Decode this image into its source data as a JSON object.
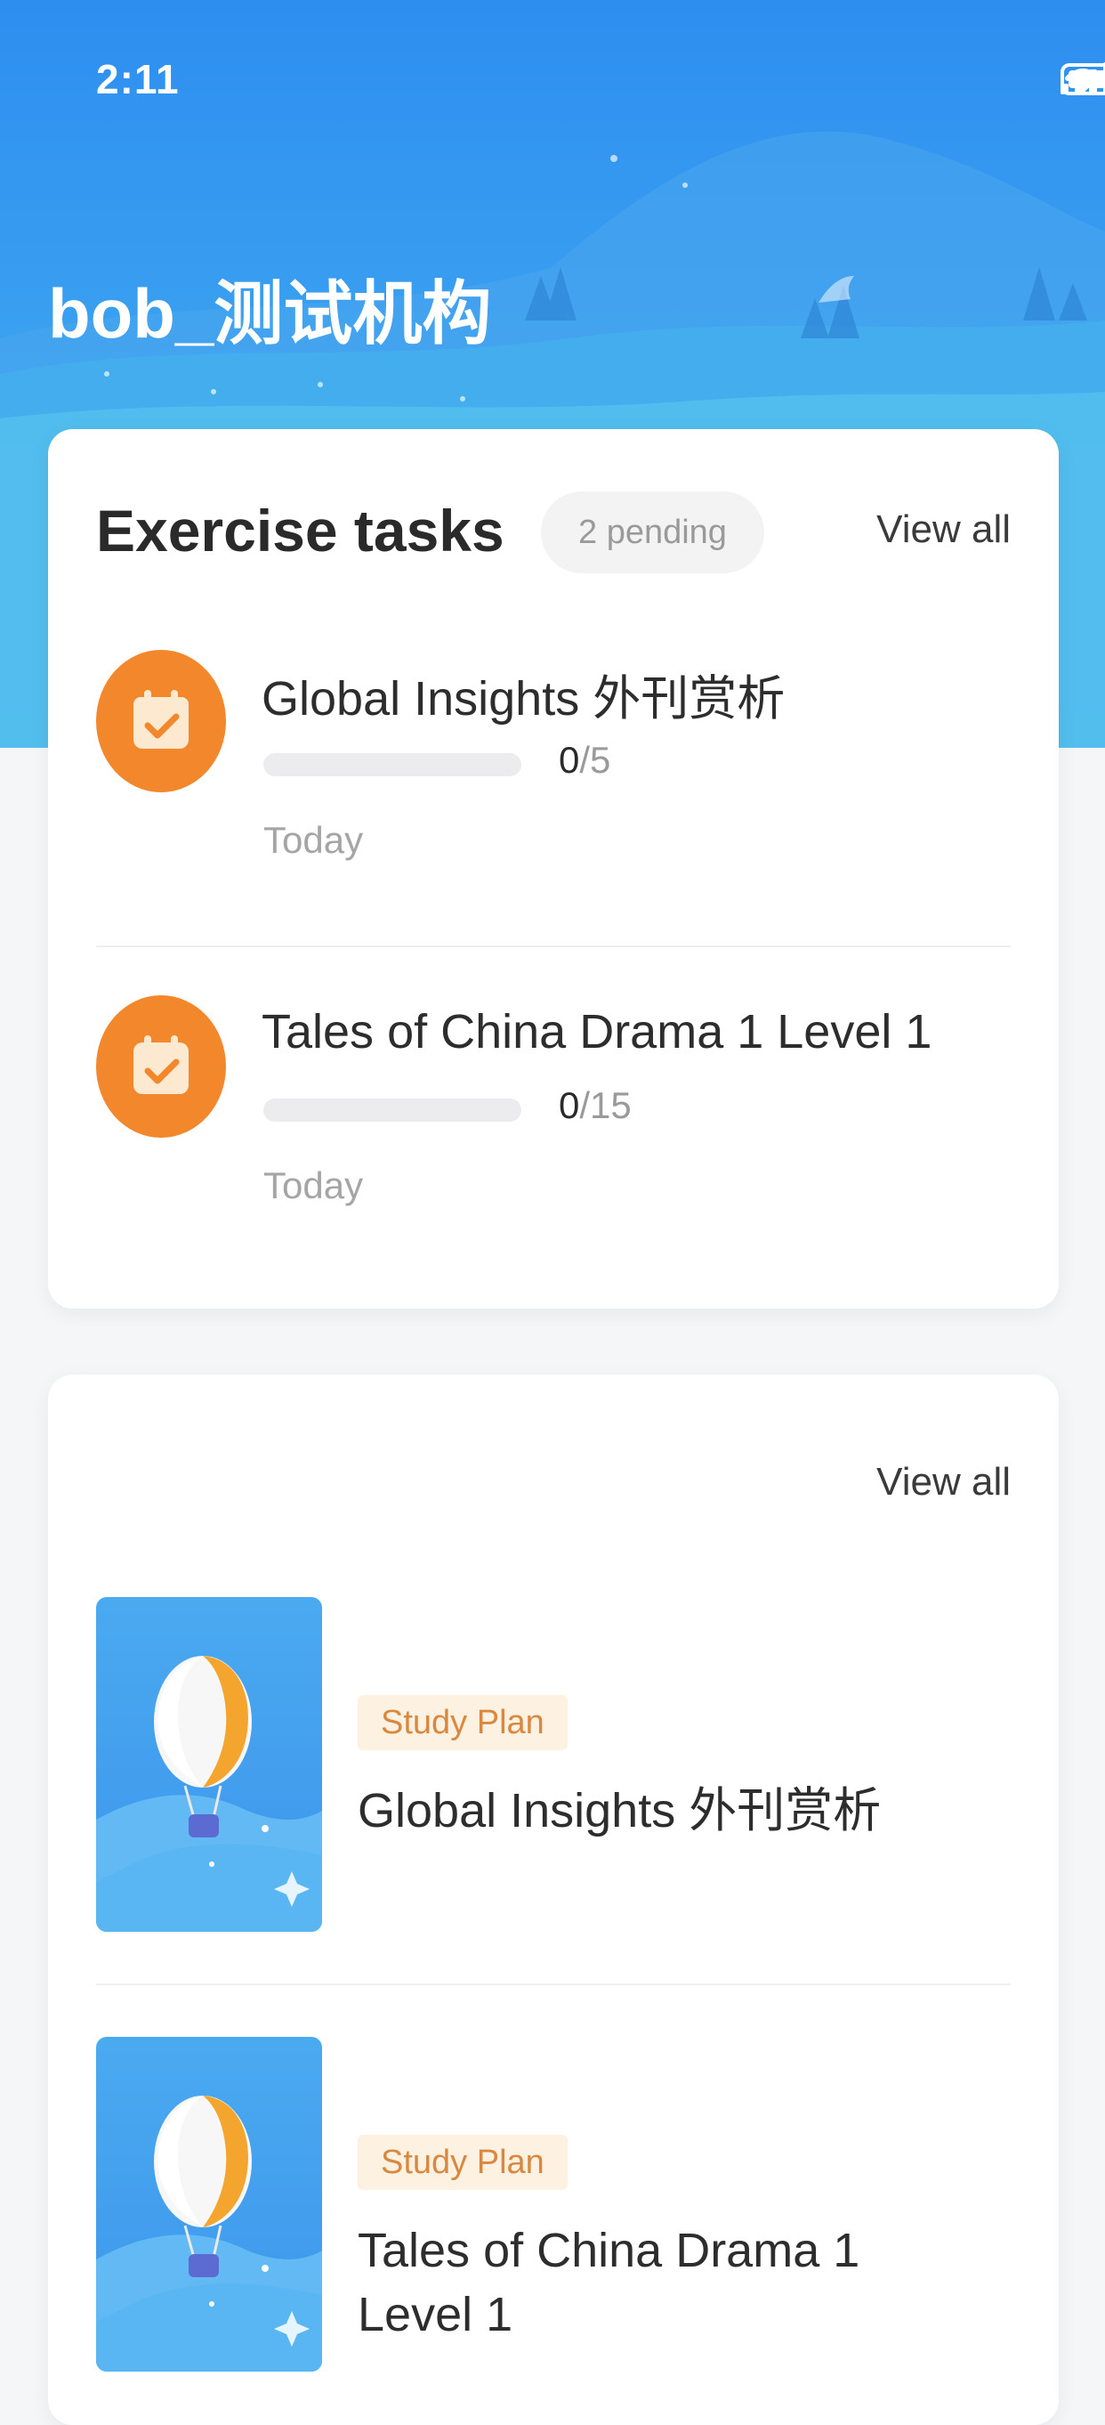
{
  "status_bar": {
    "time": "2:11"
  },
  "header": {
    "org_title": "bob_测试机构"
  },
  "exercise_tasks": {
    "title": "Exercise tasks",
    "pending_badge": "2 pending",
    "view_all_label": "View all",
    "items": [
      {
        "title": "Global Insights 外刊赏析",
        "progress_done": "0",
        "progress_total": "/5",
        "progress_fraction": 0,
        "date": "Today",
        "icon": "calendar-check-icon"
      },
      {
        "title": "Tales of China Drama 1 Level 1",
        "progress_done": "0",
        "progress_total": "/15",
        "progress_fraction": 0,
        "date": "Today",
        "icon": "calendar-check-icon"
      }
    ]
  },
  "study_plans": {
    "view_all_label": "View all",
    "items": [
      {
        "badge": "Study Plan",
        "title": "Global Insights 外刊赏析",
        "cover_icon": "hot-air-balloon-icon"
      },
      {
        "badge": "Study Plan",
        "title": "Tales of China Drama 1 Level 1",
        "cover_icon": "hot-air-balloon-icon"
      }
    ]
  },
  "colors": {
    "brand_blue": "#2e8ef0",
    "task_icon_orange": "#f2872b",
    "badge_text": "#d9893f",
    "badge_bg": "#fdf1e2"
  }
}
